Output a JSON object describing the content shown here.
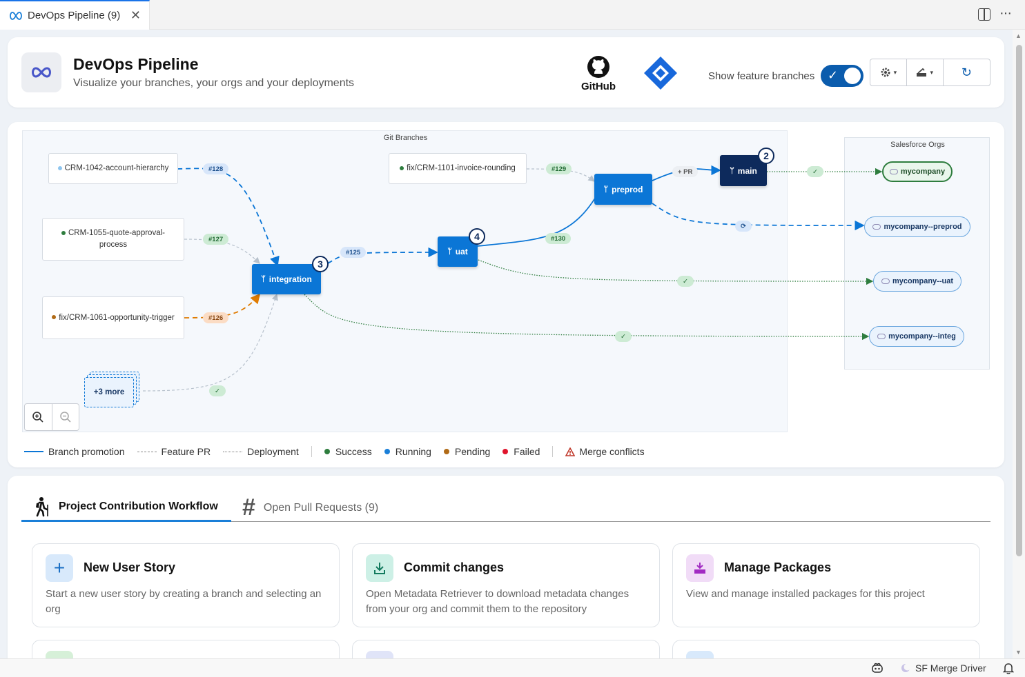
{
  "tab": {
    "title": "DevOps Pipeline (9)",
    "close": "✕"
  },
  "header": {
    "title": "DevOps Pipeline",
    "subtitle": "Visualize your branches, your orgs and your deployments",
    "github_label": "GitHub",
    "feature_toggle_label": "Show feature branches",
    "feature_toggle_on": true,
    "toggle_check": "✓",
    "caret": "▾",
    "refresh": "↻"
  },
  "pipeline": {
    "git_area_label": "Git Branches",
    "sf_area_label": "Salesforce Orgs",
    "feature_branches": [
      {
        "name": "CRM-1042-account-hierarchy",
        "status_color": "#8ec5ef"
      },
      {
        "name": "CRM-1055-quote-approval-process",
        "status_color": "#2e7d3e"
      },
      {
        "name": "fix/CRM-1061-opportunity-trigger",
        "status_color": "#b06a16"
      },
      {
        "name": "fix/CRM-1101-invoice-rounding",
        "status_color": "#2e7d3e"
      }
    ],
    "more_label": "+3 more",
    "branches": [
      {
        "name": "integration",
        "count": "3"
      },
      {
        "name": "uat",
        "count": "4"
      },
      {
        "name": "preprod",
        "count": ""
      },
      {
        "name": "main",
        "count": "2"
      }
    ],
    "prs": [
      "#128",
      "#127",
      "#126",
      "#129",
      "#125",
      "#130"
    ],
    "pr_label": "+ PR",
    "check": "✓",
    "refresh_mark": "⟳",
    "orgs": [
      "mycompany",
      "mycompany--preprod",
      "mycompany--uat",
      "mycompany--integ"
    ],
    "legend": {
      "promotion": "Branch promotion",
      "feature_pr": "Feature PR",
      "deployment": "Deployment",
      "success": "Success",
      "running": "Running",
      "pending": "Pending",
      "failed": "Failed",
      "conflicts": "Merge conflicts"
    },
    "colors": {
      "promotion": "#0b76d6",
      "success": "#2e7d3e",
      "running": "#1a7fd8",
      "pending": "#b06a16",
      "failed": "#e0142c",
      "conflict": "#c0392b"
    }
  },
  "workflow": {
    "tabs": [
      {
        "label": "Project Contribution Workflow",
        "active": true
      },
      {
        "label": "Open Pull Requests (9)",
        "active": false
      }
    ],
    "actions": [
      {
        "name": "New User Story",
        "desc": "Start a new user story by creating a branch and selecting an org"
      },
      {
        "name": "Commit changes",
        "desc": "Open Metadata Retriever to download metadata changes from your org and commit them to the repository"
      },
      {
        "name": "Manage Packages",
        "desc": "View and manage installed packages for this project"
      }
    ]
  },
  "statusbar": {
    "merge_driver": "SF Merge Driver"
  }
}
